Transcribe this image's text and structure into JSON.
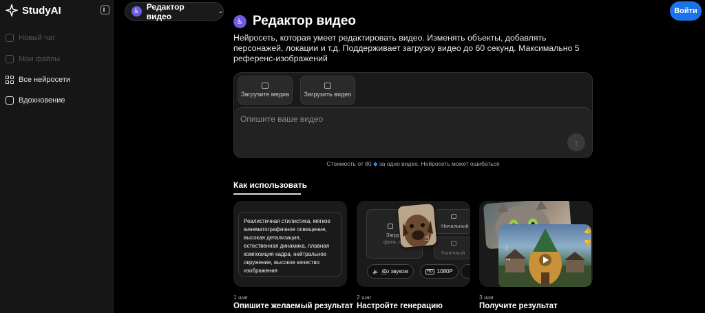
{
  "brand": {
    "name": "StudyAI"
  },
  "sidebar": {
    "items": [
      {
        "label": "Новый чат",
        "icon": "new-chat-icon"
      },
      {
        "label": "Мои файлы",
        "icon": "files-icon"
      },
      {
        "label": "Все нейросети",
        "icon": "grid-icon"
      },
      {
        "label": "Вдохновение",
        "icon": "image-icon"
      }
    ]
  },
  "header": {
    "model_label": "Редактор видео",
    "login_label": "Войти"
  },
  "main": {
    "title": "Редактор видео",
    "description": "Нейросеть, которая умеет редактировать видео. Изменять объекты, добавлять персонажей, локации и т.д. Поддерживает загрузку видео до 60 секунд. Максимально 5 референс-изображений",
    "upload_media_label": "Загрузите медиа",
    "upload_video_label": "Загрузить видео",
    "prompt_placeholder": "Опишите ваше видео",
    "cost_prefix": "Стоимость от 80",
    "cost_suffix": "за одно видео. Нейросеть может ошибаться",
    "howto_tab": "Как использовать"
  },
  "steps": [
    {
      "number": "1 шаг",
      "title": "Опишите желаемый результат",
      "example": "Реалистичная стилистика, мягкое кинематографичное освещение, высокая детализация, естественная динамика, плавная композиция кадра, нейтральное окружение, высокое качество изображения"
    },
    {
      "number": "2 шаг",
      "title": "Настройте генерацию",
      "upload_label": "Загрузит",
      "upload_sub": "фото, видео",
      "start_label": "Начальный",
      "end_label": "Конечный",
      "sound_label": "Со звуком",
      "quality_label": "1080P"
    },
    {
      "number": "3 шаг",
      "title": "Получите результат"
    }
  ],
  "colors": {
    "accent": "#1a73e8",
    "badge": "#6c5ce7",
    "diamond": "#1e90ff"
  }
}
